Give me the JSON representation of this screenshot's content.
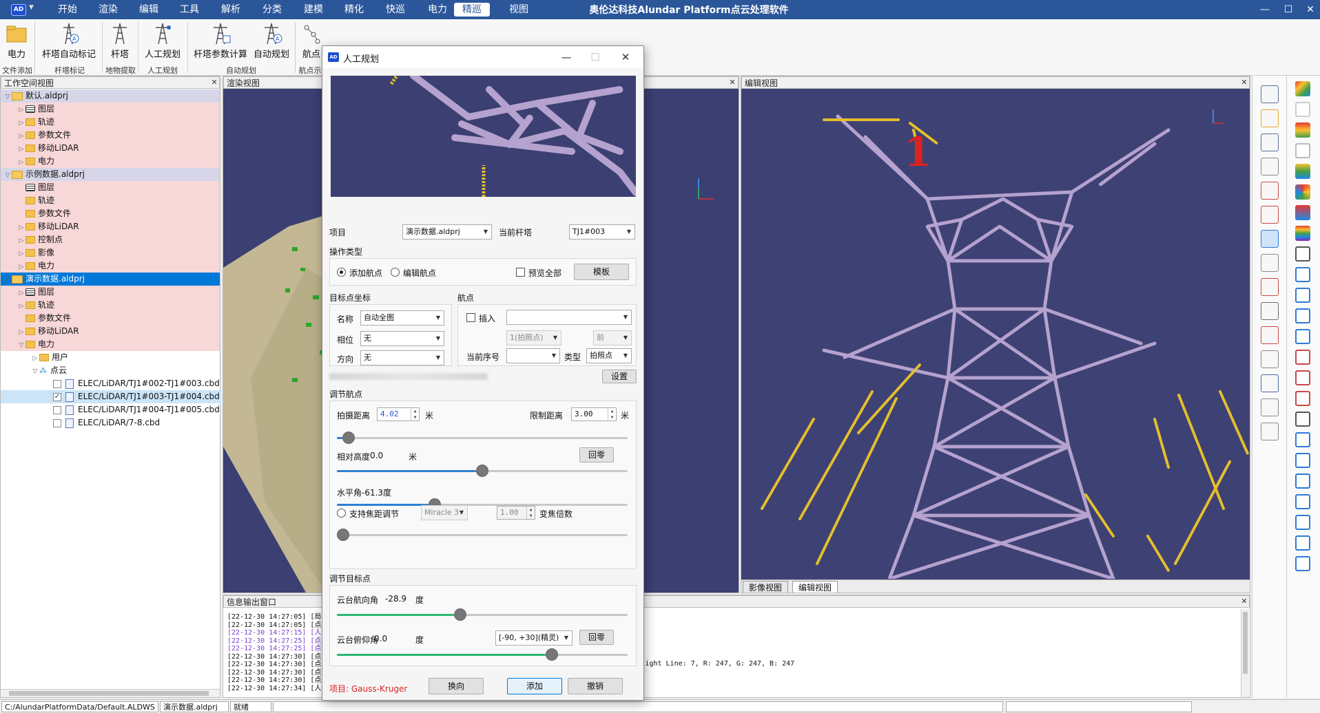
{
  "app": {
    "title": "奥伦达科技Alundar Platform点云处理软件",
    "logo": "AD"
  },
  "menu": [
    "开始",
    "渲染",
    "编辑",
    "工具",
    "解析",
    "分类",
    "建模",
    "精化",
    "快巡",
    "电力",
    "精巡",
    "视图"
  ],
  "menu_active": "精巡",
  "ribbon": {
    "buttons": [
      "电力",
      "杆塔自动标记",
      "杆塔",
      "人工规划",
      "杆塔参数计算",
      "自动规划",
      "航点"
    ],
    "groups": [
      "文件添加",
      "杆塔标记",
      "地物提取",
      "人工规划",
      "自动规划",
      "航点示"
    ]
  },
  "workspace": {
    "title": "工作空间视图",
    "rows": [
      {
        "text": "默认.aldprj",
        "style": "gray",
        "depth": 0,
        "icon": "proj",
        "arrow": "▽"
      },
      {
        "text": "图层",
        "style": "pink",
        "depth": 1,
        "icon": "layers",
        "arrow": "▷"
      },
      {
        "text": "轨迹",
        "style": "pink",
        "depth": 1,
        "icon": "folder",
        "arrow": "▷"
      },
      {
        "text": "参数文件",
        "style": "pink",
        "depth": 1,
        "icon": "folder",
        "arrow": "▷"
      },
      {
        "text": "移动LiDAR",
        "style": "pink",
        "depth": 1,
        "icon": "folder",
        "arrow": "▷"
      },
      {
        "text": "电力",
        "style": "pink",
        "depth": 1,
        "icon": "folder",
        "arrow": "▷"
      },
      {
        "text": "示例数据.aldprj",
        "style": "gray",
        "depth": 0,
        "icon": "proj",
        "arrow": "▽"
      },
      {
        "text": "图层",
        "style": "pink",
        "depth": 1,
        "icon": "layers",
        "arrow": ""
      },
      {
        "text": "轨迹",
        "style": "pink",
        "depth": 1,
        "icon": "folder",
        "arrow": ""
      },
      {
        "text": "参数文件",
        "style": "pink",
        "depth": 1,
        "icon": "folder",
        "arrow": ""
      },
      {
        "text": "移动LiDAR",
        "style": "pink",
        "depth": 1,
        "icon": "folder",
        "arrow": "▷"
      },
      {
        "text": "控制点",
        "style": "pink",
        "depth": 1,
        "icon": "folder",
        "arrow": "▷"
      },
      {
        "text": "影像",
        "style": "pink",
        "depth": 1,
        "icon": "folder",
        "arrow": "▷"
      },
      {
        "text": "电力",
        "style": "pink",
        "depth": 1,
        "icon": "folder",
        "arrow": "▷"
      },
      {
        "text": "演示数据.aldprj",
        "style": "sel",
        "depth": 0,
        "icon": "proj",
        "arrow": "▽"
      },
      {
        "text": "图层",
        "style": "pink",
        "depth": 1,
        "icon": "layers",
        "arrow": "▷"
      },
      {
        "text": "轨迹",
        "style": "pink",
        "depth": 1,
        "icon": "folder",
        "arrow": "▷"
      },
      {
        "text": "参数文件",
        "style": "pink",
        "depth": 1,
        "icon": "folder",
        "arrow": ""
      },
      {
        "text": "移动LiDAR",
        "style": "pink",
        "depth": 1,
        "icon": "folder",
        "arrow": "▷"
      },
      {
        "text": "电力",
        "style": "pink",
        "depth": 1,
        "icon": "folder",
        "arrow": "▽"
      },
      {
        "text": "用户",
        "style": "",
        "depth": 2,
        "icon": "folder",
        "arrow": "▷"
      },
      {
        "text": "点云",
        "style": "",
        "depth": 2,
        "icon": "cloud",
        "arrow": "▽"
      },
      {
        "text": "ELEC/LiDAR/TJ1#002-TJ1#003.cbd",
        "style": "",
        "depth": 3,
        "icon": "file",
        "arrow": "",
        "check": false
      },
      {
        "text": "ELEC/LiDAR/TJ1#003-TJ1#004.cbd",
        "style": "lightsel",
        "depth": 3,
        "icon": "file",
        "arrow": "",
        "check": true
      },
      {
        "text": "ELEC/LiDAR/TJ1#004-TJ1#005.cbd",
        "style": "",
        "depth": 3,
        "icon": "file",
        "arrow": "",
        "check": false
      },
      {
        "text": "ELEC/LiDAR/7-8.cbd",
        "style": "",
        "depth": 3,
        "icon": "file",
        "arrow": "",
        "check": false
      }
    ]
  },
  "render_view": {
    "title": "渲染视图"
  },
  "edit_view": {
    "title": "编辑视图",
    "marker": "1",
    "tabs": [
      "影像视图",
      "编辑视图"
    ],
    "active_tab": "编辑视图"
  },
  "info_output": {
    "title": "信息输出窗口",
    "lines": [
      {
        "text": "[22-12-30 14:27:05] [局",
        "color": "#111"
      },
      {
        "text": "[22-12-30 14:27:05] [点",
        "color": "#111"
      },
      {
        "text": "[22-12-30 14:27:15] [人",
        "color": "#7b3fd0"
      },
      {
        "text": "[22-12-30 14:27:25] [点",
        "color": "#7b3fd0"
      },
      {
        "text": "[22-12-30 14:27:25] [点",
        "color": "#7b3fd0"
      },
      {
        "text": "[22-12-30 14:27:30] [点",
        "color": "#111"
      },
      {
        "text": "[22-12-30 14:27:30] [点",
        "color": "#111"
      },
      {
        "text": "[22-12-30 14:27:30] [点",
        "color": "#111"
      },
      {
        "text": "[22-12-30 14:27:30] [点",
        "color": "#111"
      },
      {
        "text": "[22-12-30 14:27:34] [人",
        "color": "#111"
      }
    ],
    "point_info": "1: 15 杆塔, Return: 0, Flight Line: 7, R: 247, G: 247, B: 247"
  },
  "statusbar": {
    "path": "C:/AlundarPlatformData/Default.ALDWS",
    "project": "演示数据.aldprj",
    "state": "就绪"
  },
  "dialog": {
    "title": "人工规划",
    "project_label": "项目",
    "project_value": "演示数据.aldprj",
    "tower_label": "当前杆塔",
    "tower_value": "TJ1#003",
    "op_type_label": "操作类型",
    "add_waypoint": "添加航点",
    "edit_waypoint": "编辑航点",
    "add_selected": true,
    "preview_all": "预览全部",
    "template_btn": "模板",
    "target_coord_label": "目标点坐标",
    "name_label": "名称",
    "name_value": "自动全图",
    "phase_label": "相位",
    "phase_value": "无",
    "direction_label": "方向",
    "direction_value": "无",
    "waypoint_label": "航点",
    "insert_label": "插入",
    "insert_value": "",
    "shot_value": "1(拍照点)",
    "front_value": "前",
    "current_index_label": "当前序号",
    "current_index_value": "",
    "type_label": "类型",
    "type_value": "拍照点",
    "settings_btn": "设置",
    "adjust_waypoint_label": "调节航点",
    "shoot_dist_label": "拍摄距离",
    "shoot_dist_value": "4.02",
    "meter": "米",
    "limit_dist_label": "限制距离",
    "limit_dist_value": "3.00",
    "shoot_dist_slider": 0.02,
    "rel_height_label": "相对高度",
    "rel_height_value": "0.0",
    "rel_height_slider": 0.5,
    "reset_btn": "回零",
    "horiz_angle_label": "水平角-61.3度",
    "horiz_angle_slider": 0.33,
    "zoom_label": "支持焦距调节",
    "camera_value": "Miracle 3",
    "zoom_value": "1.00",
    "zoom_factor_label": "变焦倍数",
    "zoom_slider": 0.0,
    "adjust_target_label": "调节目标点",
    "yaw_label": "云台航向角",
    "yaw_value": "-28.9",
    "degree": "度",
    "yaw_slider": 0.42,
    "pitch_label": "云台俯仰角",
    "pitch_value": "0.0",
    "pitch_range_value": "[-90, +30](精灵)",
    "pitch_slider": 0.75,
    "project_coord": "项目: Gauss-Kruger",
    "swap_btn": "换向",
    "add_btn": "添加",
    "undo_btn": "撤销"
  },
  "colors": {
    "titlebar": "#2b579a",
    "viewport": "#3b3f72",
    "tower": "#b5a2cf",
    "conductor": "#e4bf2d",
    "accent": "#0078d7",
    "slider_blue": "#2f7fd6",
    "slider_green": "#2bb673",
    "warning_red": "#d9231f"
  }
}
